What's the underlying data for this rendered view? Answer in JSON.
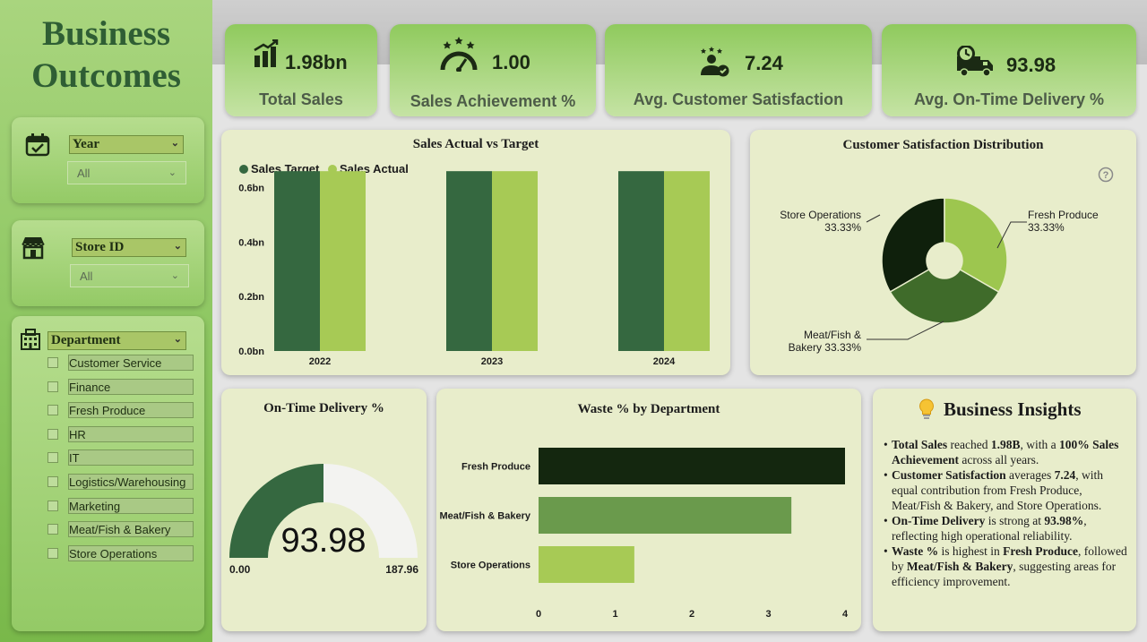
{
  "sidebar": {
    "title_line1": "Business",
    "title_line2": "Outcomes",
    "year_slicer": {
      "label": "Year",
      "value": "All"
    },
    "store_slicer": {
      "label": "Store ID",
      "value": "All"
    },
    "dept_slicer": {
      "label": "Department",
      "items": [
        "Customer Service",
        "Finance",
        "Fresh Produce",
        "HR",
        "IT",
        "Logistics/Warehousing",
        "Marketing",
        "Meat/Fish & Bakery",
        "Store Operations"
      ]
    }
  },
  "kpis": [
    {
      "value": "1.98bn",
      "label": "Total Sales",
      "icon": "bar-chart-icon"
    },
    {
      "value": "1.00",
      "label": "Sales Achievement %",
      "icon": "speedometer-icon"
    },
    {
      "value": "7.24",
      "label": "Avg. Customer Satisfaction",
      "icon": "customer-stars-icon"
    },
    {
      "value": "93.98",
      "label": "Avg. On-Time Delivery %",
      "icon": "delivery-truck-icon"
    }
  ],
  "colors": {
    "dark_green": "#356840",
    "light_green": "#a7ca55",
    "mid_green": "#6a9a4c",
    "darkest_green": "#14270f"
  },
  "sales_chart": {
    "title": "Sales Actual vs Target",
    "legend": [
      "Sales Target",
      "Sales Actual"
    ],
    "chart_data": {
      "type": "bar",
      "categories": [
        "2022",
        "2023",
        "2024"
      ],
      "series": [
        {
          "name": "Sales Target",
          "values": [
            0.66,
            0.66,
            0.66
          ]
        },
        {
          "name": "Sales Actual",
          "values": [
            0.66,
            0.66,
            0.66
          ]
        }
      ],
      "ylim": [
        0,
        0.7
      ],
      "yticks": [
        "0.0bn",
        "0.2bn",
        "0.4bn",
        "0.6bn"
      ],
      "ytick_values": [
        0,
        0.2,
        0.4,
        0.6
      ]
    }
  },
  "satisfaction_chart": {
    "title": "Customer Satisfaction Distribution",
    "chart_data": {
      "type": "pie",
      "slices": [
        {
          "name": "Fresh Produce",
          "value": 33.33,
          "label": "33.33%",
          "color": "#9dc64f"
        },
        {
          "name": "Meat/Fish & Bakery",
          "value": 33.33,
          "label": "33.33%",
          "color": "#3f6b2a"
        },
        {
          "name": "Store Operations",
          "value": 33.33,
          "label": "33.33%",
          "color": "#0f200c"
        }
      ]
    },
    "label_fresh_name": "Fresh Produce",
    "label_fresh_pct": "33.33%",
    "label_store_name": "Store Operations",
    "label_store_pct": "33.33%",
    "label_meat_line1": "Meat/Fish &",
    "label_meat_line2": "Bakery 33.33%"
  },
  "delivery_gauge": {
    "title": "On-Time Delivery %",
    "value_text": "93.98",
    "min_text": "0.00",
    "max_text": "187.96",
    "chart_data": {
      "type": "gauge",
      "value": 93.98,
      "min": 0,
      "max": 187.96
    }
  },
  "waste_chart": {
    "title": "Waste % by Department",
    "chart_data": {
      "type": "bar",
      "orientation": "horizontal",
      "categories": [
        "Fresh Produce",
        "Meat/Fish & Bakery",
        "Store Operations"
      ],
      "values": [
        4.0,
        3.3,
        1.25
      ],
      "colors": [
        "#14270f",
        "#6a9a4c",
        "#a7ca55"
      ],
      "xlim": [
        0,
        4
      ],
      "xticks": [
        "0",
        "1",
        "2",
        "3",
        "4"
      ]
    }
  },
  "insights": {
    "title": "Business Insights",
    "b1_k1": "Total Sales",
    "b1_t1": " reached ",
    "b1_k2": "1.98B",
    "b1_t2": ", with a ",
    "b1_k3": "100% Sales Achievement",
    "b1_t3": " across all years.",
    "b2_k1": "Customer Satisfaction",
    "b2_t1": " averages ",
    "b2_k2": "7.24",
    "b2_t2": ", with equal contribution from Fresh Produce, Meat/Fish & Bakery, and Store Operations.",
    "b3_k1": "On-Time Delivery",
    "b3_t1": " is strong at ",
    "b3_k2": "93.98%",
    "b3_t2": ", reflecting high operational reliability.",
    "b4_k1": "Waste %",
    "b4_t1": " is highest in ",
    "b4_k2": "Fresh Produce",
    "b4_t2": ", followed by ",
    "b4_k3": "Meat/Fish & Bakery",
    "b4_t3": ", suggesting areas for efficiency improvement."
  }
}
